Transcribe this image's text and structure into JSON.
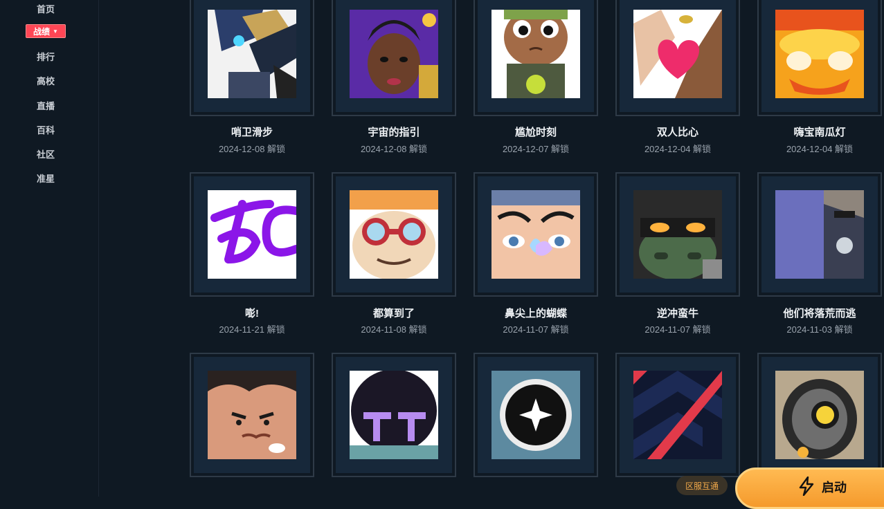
{
  "sidebar": {
    "items": [
      {
        "label": "首页"
      },
      {
        "label": "战绩",
        "active": true
      },
      {
        "label": "排行"
      },
      {
        "label": "高校"
      },
      {
        "label": "直播"
      },
      {
        "label": "百科"
      },
      {
        "label": "社区"
      },
      {
        "label": "准星"
      }
    ]
  },
  "cards": [
    {
      "title": "哨卫滑步",
      "date": "2024-12-08 解锁",
      "icon": "sentinel-robot-icon"
    },
    {
      "title": "宇宙的指引",
      "date": "2024-12-08 解锁",
      "icon": "astra-portrait-icon"
    },
    {
      "title": "尴尬时刻",
      "date": "2024-12-07 解锁",
      "icon": "awkward-kid-icon"
    },
    {
      "title": "双人比心",
      "date": "2024-12-04 解锁",
      "icon": "heart-hands-icon"
    },
    {
      "title": "嗨宝南瓜灯",
      "date": "2024-12-04 解锁",
      "icon": "pumpkin-lantern-icon"
    },
    {
      "title": "嘭!",
      "date": "2024-11-21 解锁",
      "icon": "purple-graffiti-icon"
    },
    {
      "title": "都算到了",
      "date": "2024-11-08 解锁",
      "icon": "goggles-face-icon"
    },
    {
      "title": "鼻尖上的蝴蝶",
      "date": "2024-11-07 解锁",
      "icon": "butterfly-nose-icon"
    },
    {
      "title": "逆冲蛮牛",
      "date": "2024-11-07 解锁",
      "icon": "masked-bull-icon"
    },
    {
      "title": "他们将落荒而逃",
      "date": "2024-11-03 解锁",
      "icon": "purple-robot-icon"
    },
    {
      "title": "",
      "date": "",
      "icon": "grumpy-face-icon"
    },
    {
      "title": "",
      "date": "",
      "icon": "dark-helmet-icon"
    },
    {
      "title": "",
      "date": "",
      "icon": "sparkle-orb-icon"
    },
    {
      "title": "",
      "date": "",
      "icon": "red-chevron-icon"
    },
    {
      "title": "",
      "date": "",
      "icon": "camera-eye-icon"
    }
  ],
  "footer": {
    "region_badge": "区服互通",
    "launch_label": "启动"
  },
  "colors": {
    "background": "#0f1923",
    "accent": "#ff4655",
    "launch": "#f5a43a"
  }
}
